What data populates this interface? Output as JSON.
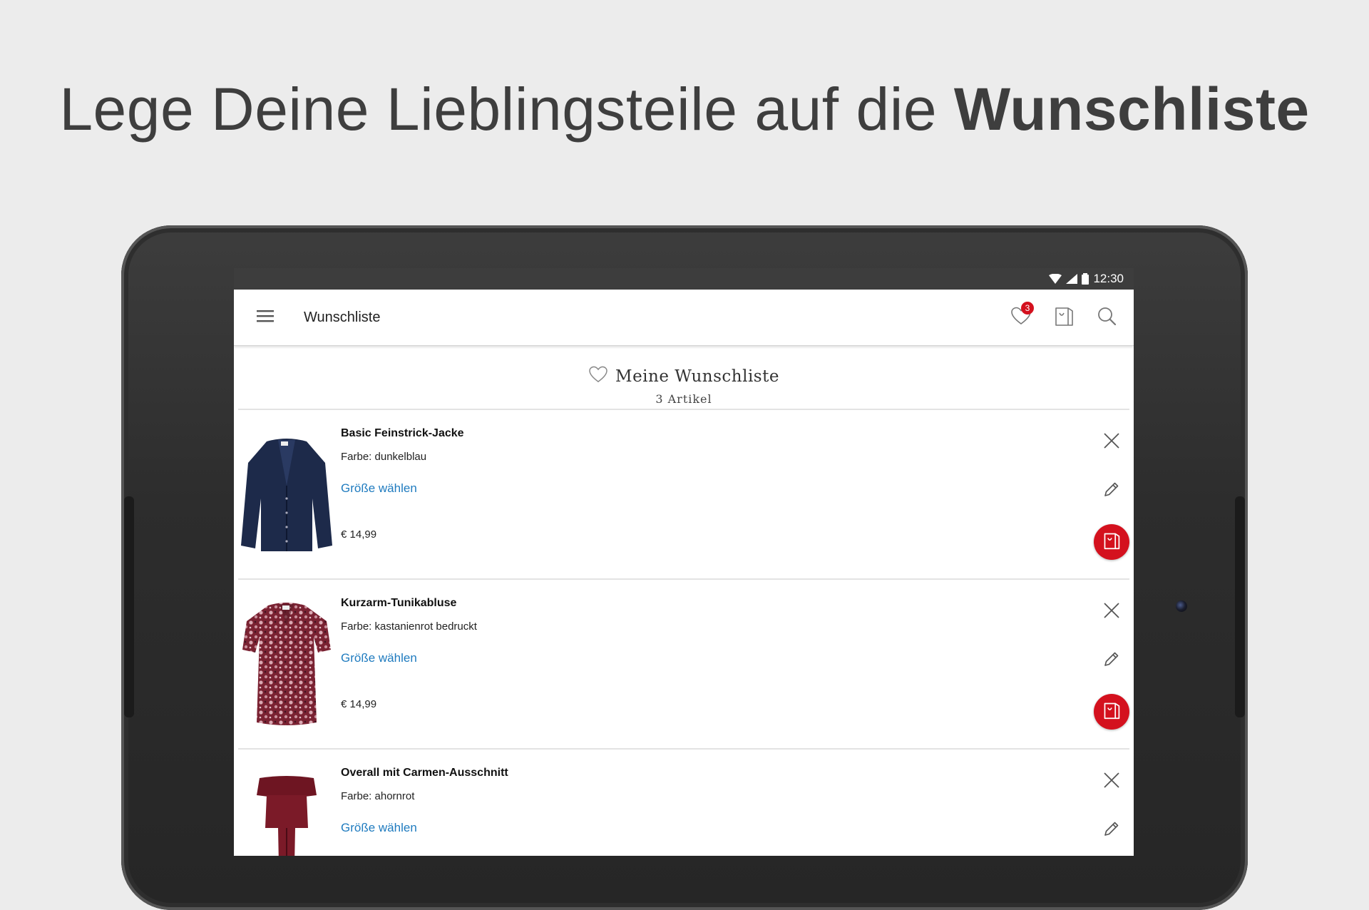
{
  "promo": {
    "headline_regular": "Lege Deine Lieblingsteile auf die ",
    "headline_bold": "Wunschliste"
  },
  "statusbar": {
    "time": "12:30"
  },
  "toolbar": {
    "title": "Wunschliste",
    "wishlist_badge": "3",
    "icons": [
      "menu-icon",
      "heart-icon",
      "shopping-bag-icon",
      "search-icon"
    ]
  },
  "wishlist": {
    "title": "Meine Wunschliste",
    "count": "3 Artikel",
    "items": [
      {
        "name": "Basic Feinstrick-Jacke",
        "color": "Farbe: dunkelblau",
        "size_link": "Größe wählen",
        "price": "€ 14,99"
      },
      {
        "name": "Kurzarm-Tunikabluse",
        "color": "Farbe: kastanienrot bedruckt",
        "size_link": "Größe wählen",
        "price": "€ 14,99"
      },
      {
        "name": "Overall mit Carmen-Ausschnitt",
        "color": "Farbe: ahornrot",
        "size_link": "Größe wählen",
        "price": ""
      }
    ]
  },
  "colors": {
    "accent": "#d4111e",
    "link": "#1f7bbf",
    "statusbar": "#3d3d3d",
    "background": "#ececec"
  }
}
